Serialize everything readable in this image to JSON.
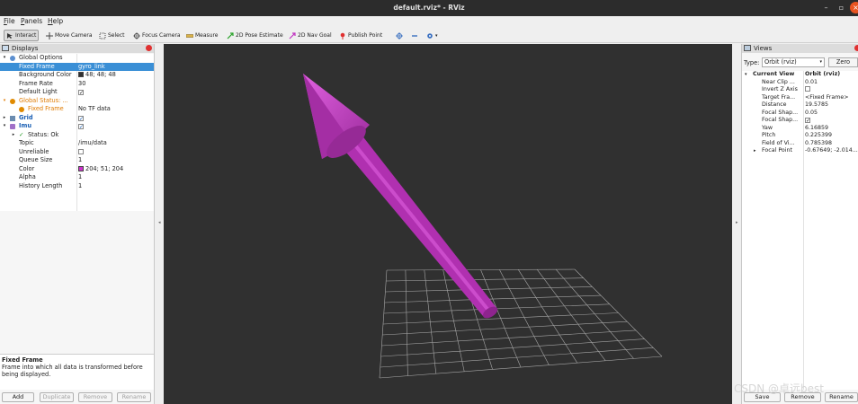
{
  "window": {
    "title": "default.rviz* - RViz"
  },
  "menu": [
    {
      "key": "F",
      "rest": "ile"
    },
    {
      "key": "P",
      "rest": "anels"
    },
    {
      "key": "H",
      "rest": "elp"
    }
  ],
  "toolbar": {
    "interact": "Interact",
    "move_camera": "Move Camera",
    "select": "Select",
    "focus_camera": "Focus Camera",
    "measure": "Measure",
    "pose_estimate": "2D Pose Estimate",
    "nav_goal": "2D Nav Goal",
    "publish_point": "Publish Point"
  },
  "displays": {
    "title": "Displays",
    "rows": [
      {
        "label": "Global Options",
        "value": ""
      },
      {
        "label": "Fixed Frame",
        "value": "gyro_link"
      },
      {
        "label": "Background Color",
        "value": "48; 48; 48"
      },
      {
        "label": "Frame Rate",
        "value": "30"
      },
      {
        "label": "Default Light",
        "value": "✓"
      },
      {
        "label": "Global Status: ...",
        "value": ""
      },
      {
        "label": "Fixed Frame",
        "value": "No TF data"
      },
      {
        "label": "Grid",
        "value": "✓"
      },
      {
        "label": "Imu",
        "value": "✓"
      },
      {
        "label": "Status: Ok",
        "value": ""
      },
      {
        "label": "Topic",
        "value": "/imu/data"
      },
      {
        "label": "Unreliable",
        "value": ""
      },
      {
        "label": "Queue Size",
        "value": "1"
      },
      {
        "label": "Color",
        "value": "204; 51; 204"
      },
      {
        "label": "Alpha",
        "value": "1"
      },
      {
        "label": "History Length",
        "value": "1"
      }
    ],
    "description_title": "Fixed Frame",
    "description_text": "Frame into which all data is transformed before being displayed.",
    "buttons": {
      "add": "Add",
      "duplicate": "Duplicate",
      "remove": "Remove",
      "rename": "Rename"
    }
  },
  "views": {
    "title": "Views",
    "type_label": "Type:",
    "type_value": "Orbit (rviz)",
    "zero_button": "Zero",
    "rows": [
      {
        "label": "Current View",
        "value": "Orbit (rviz)"
      },
      {
        "label": "Near Clip ...",
        "value": "0.01"
      },
      {
        "label": "Invert Z Axis",
        "value": ""
      },
      {
        "label": "Target Fra...",
        "value": "<Fixed Frame>"
      },
      {
        "label": "Distance",
        "value": "19.5785"
      },
      {
        "label": "Focal Shap...",
        "value": "0.05"
      },
      {
        "label": "Focal Shap...",
        "value": "✓"
      },
      {
        "label": "Yaw",
        "value": "6.16859"
      },
      {
        "label": "Pitch",
        "value": "0.225399"
      },
      {
        "label": "Field of Vi...",
        "value": "0.785398"
      },
      {
        "label": "Focal Point",
        "value": "-0.67649; -2.014..."
      }
    ],
    "buttons": {
      "save": "Save",
      "remove": "Remove",
      "rename": "Rename"
    }
  },
  "colors": {
    "background": "#303030",
    "arrow": "#cc33cc",
    "bg_swatch": "#303030",
    "imu_swatch": "#cc33cc",
    "selection": "#3a8fd6"
  },
  "watermark": "CSDN @卓远best"
}
